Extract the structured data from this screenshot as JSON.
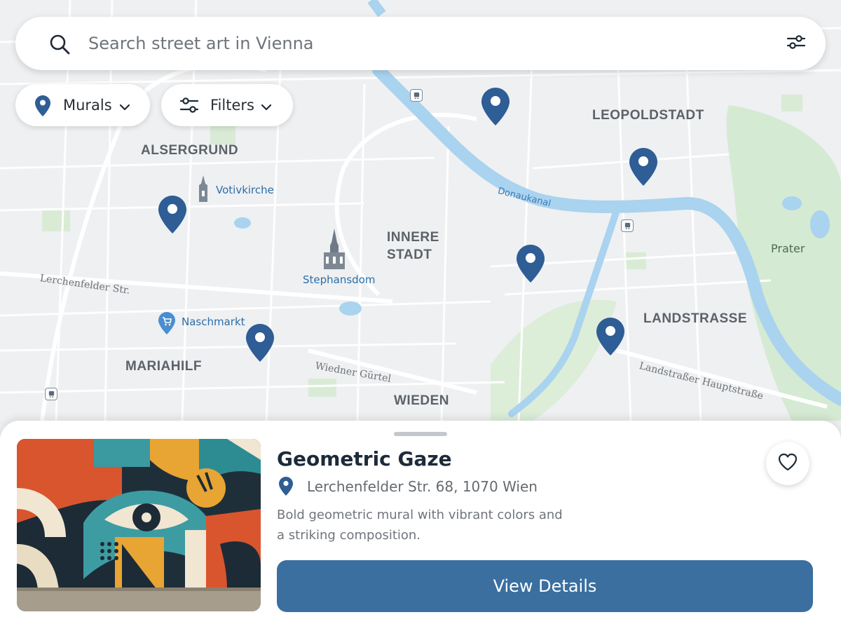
{
  "search": {
    "placeholder": "Search street art in Vienna",
    "icon": "search-icon",
    "settings_icon": "sliders-icon"
  },
  "chips": {
    "murals": {
      "label": "Murals",
      "icon": "map-pin-icon"
    },
    "filters": {
      "label": "Filters",
      "icon": "sliders-icon"
    }
  },
  "map": {
    "districts": {
      "alsergrund": "ALSERGRUND",
      "leopoldstadt": "LEOPOLDSTADT",
      "innere_stadt_line1": "INNERE",
      "innere_stadt_line2": "STADT",
      "mariahilf": "MARIAHILF",
      "landstrasse": "LANDSTRASSE",
      "wieden": "WIEDEN"
    },
    "pois": {
      "votivkirche": "Votivkirche",
      "stephansdom": "Stephansdom",
      "naschmarkt": "Naschmarkt"
    },
    "streets": {
      "lerchenfelder": "Lerchenfelder Str.",
      "wiedner_guertel": "Wiedner Gürtel",
      "landstrasser_hauptstrasse": "Landstraßer Hauptstraße"
    },
    "water": {
      "donaukanal": "Donaukanal"
    },
    "parks": {
      "prater": "Prater"
    },
    "pin_color": "#2f5d95",
    "water_color": "#a9d3ef",
    "park_color": "#d5ead2"
  },
  "sheet": {
    "title": "Geometric Gaze",
    "address": "Lerchenfelder Str. 68, 1070 Wien",
    "description": "Bold geometric mural with vibrant colors and a striking composition.",
    "favorite_icon": "heart-icon",
    "button_label": "View Details",
    "button_color": "#3a6fa0"
  }
}
